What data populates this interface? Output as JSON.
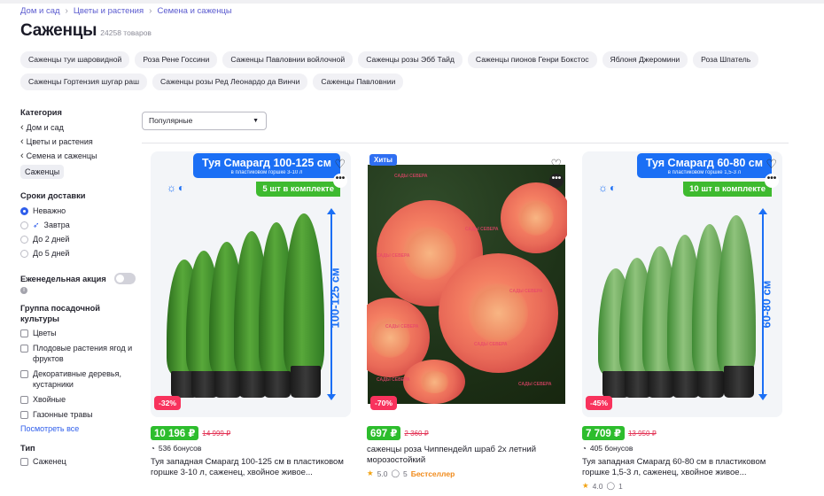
{
  "breadcrumb": [
    "Дом и сад",
    "Цветы и растения",
    "Семена и саженцы"
  ],
  "page": {
    "title": "Саженцы",
    "count": "24258 товаров"
  },
  "chips": [
    "Саженцы туи шаровидной",
    "Роза Рене Госсини",
    "Саженцы Павловнии войлочной",
    "Саженцы розы Эбб Тайд",
    "Саженцы пионов Генри Бокстос",
    "Яблоня Джеромини",
    "Роза Шпатель",
    "Саженцы Гортензия шугар раш",
    "Саженцы розы Ред Леонардо да Винчи",
    "Саженцы Павловнии"
  ],
  "sidebar": {
    "category_title": "Категория",
    "categories": [
      "Дом и сад",
      "Цветы и растения",
      "Семена и саженцы"
    ],
    "selected_category": "Саженцы",
    "delivery_title": "Сроки доставки",
    "delivery_options": [
      "Неважно",
      "Завтра",
      "До 2 дней",
      "До 5 дней"
    ],
    "promo_title": "Еженедельная акция",
    "group_title": "Группа посадочной культуры",
    "groups": [
      "Цветы",
      "Плодовые растения ягод и фруктов",
      "Декоративные деревья, кустарники",
      "Хвойные",
      "Газонные травы"
    ],
    "show_all": "Посмотреть все",
    "type_title": "Тип",
    "types": [
      "Саженец"
    ]
  },
  "sort": {
    "value": "Популярные"
  },
  "products": [
    {
      "banner_title": "Туя Смарагд 100-125 см",
      "banner_sub": "в пластиковом горшке 3-10 л",
      "tag": "5 шт в комплекте",
      "height_label": "100-125 см",
      "discount": "-32%",
      "price": "10 196 ₽",
      "old_price": "14 999 ₽",
      "bonus": "536 бонусов",
      "name": "Туя западная Смарагд 100-125 см в пластиковом горшке 3-10 л, саженец, хвойное живое..."
    },
    {
      "hit": "Хиты",
      "watermark": "САДЫ СЕВЕРА",
      "discount": "-70%",
      "price": "697 ₽",
      "old_price": "2 360 ₽",
      "name": "саженцы роза Чиппендейл шраб 2х летний морозостойкий",
      "rating": "5.0",
      "reviews": "5",
      "badge": "Бестселлер"
    },
    {
      "banner_title": "Туя Смарагд 60-80 см",
      "banner_sub": "в пластиковом горшке 1,5-3 л",
      "tag": "10 шт в комплекте",
      "height_label": "60-80 см",
      "discount": "-45%",
      "price": "7 709 ₽",
      "old_price": "13 950 ₽",
      "bonus": "405 бонусов",
      "name": "Туя западная Смарагд 60-80 см в пластиковом горшке 1,5-3 л, саженец, хвойное живое...",
      "rating": "4.0",
      "reviews": "1"
    }
  ],
  "colors": {
    "accent": "#1b6ff5",
    "price": "#2dbd2d",
    "discount": "#f8335d",
    "link": "#2f5eeb"
  }
}
